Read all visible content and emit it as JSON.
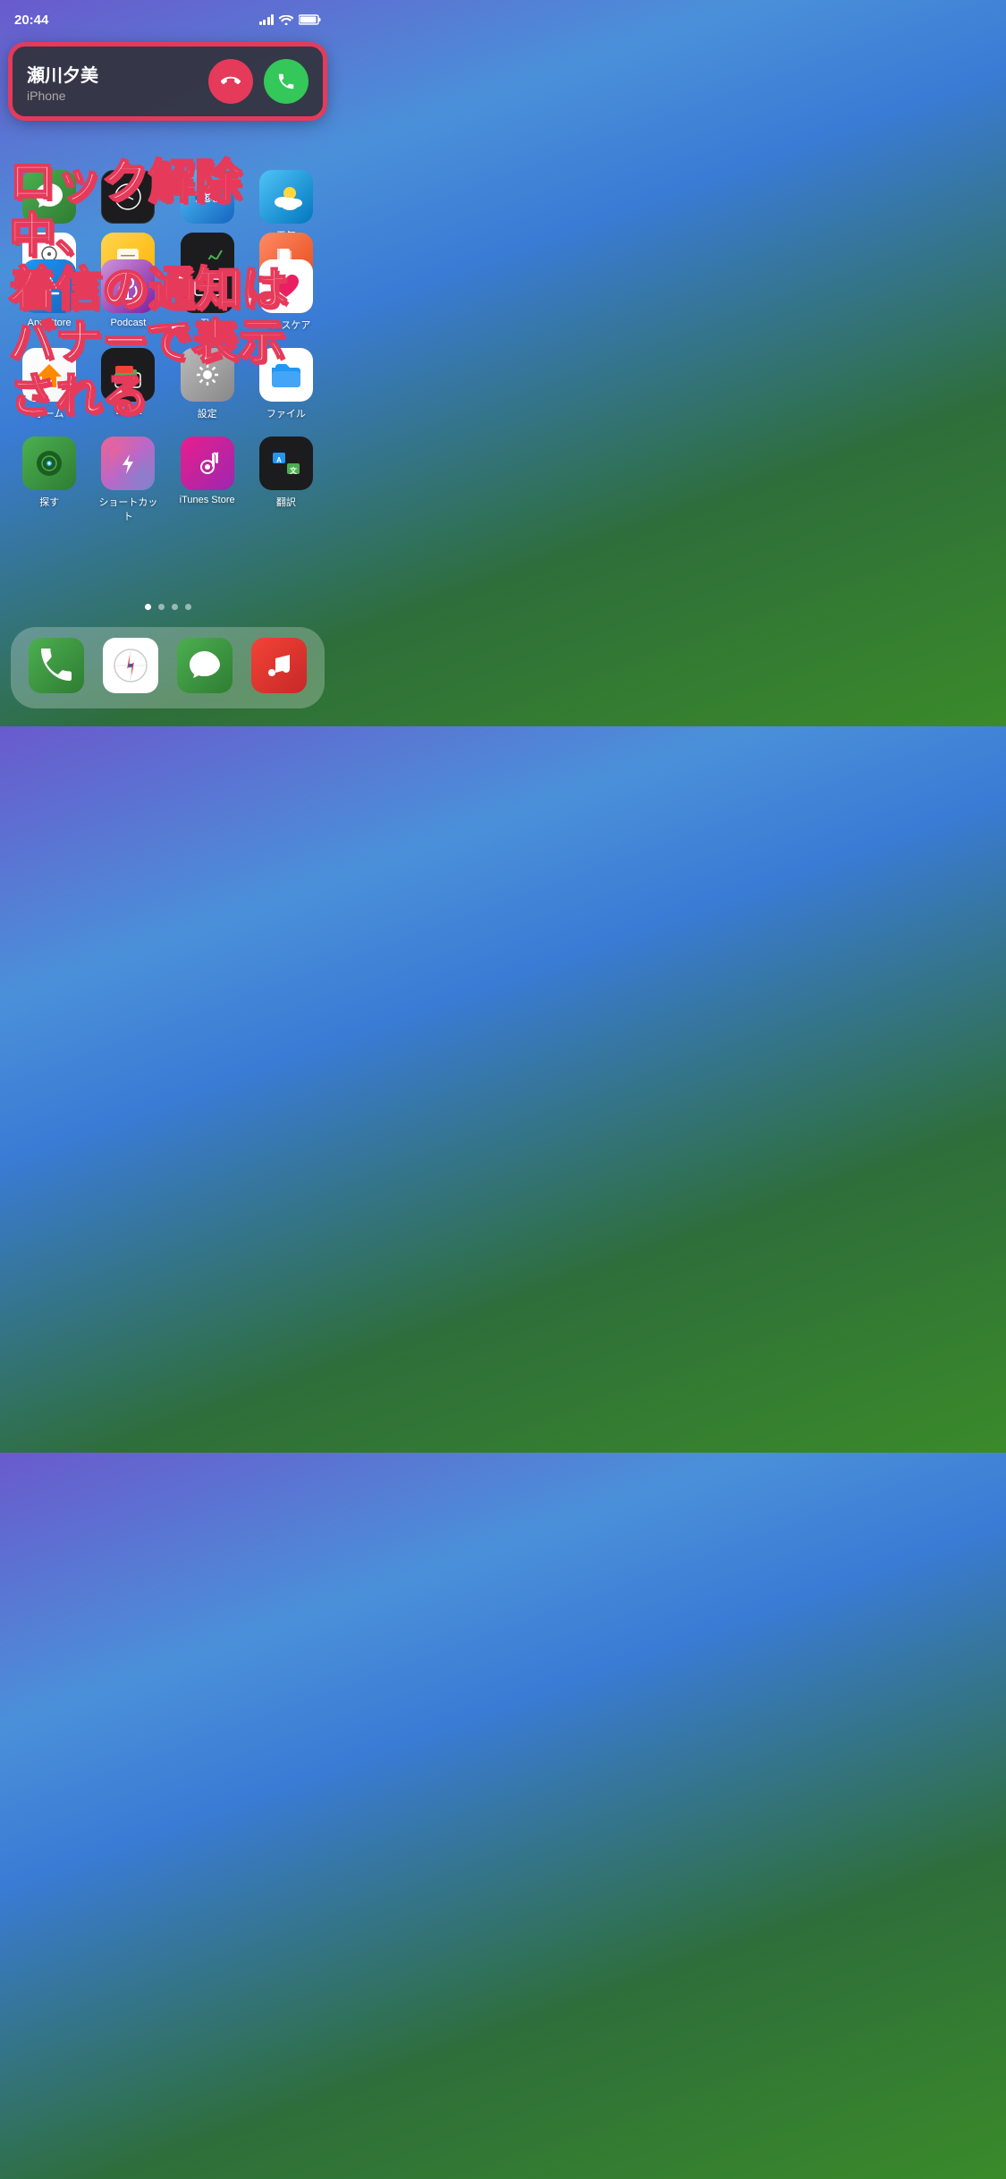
{
  "statusBar": {
    "time": "20:44"
  },
  "callBanner": {
    "callerName": "瀬川夕美",
    "callType": "iPhone",
    "declineLabel": "decline",
    "acceptLabel": "accept"
  },
  "overlayText": {
    "line1": "ロック解除中、",
    "line2": "着信の通知は",
    "line3": "バナーで表示される"
  },
  "topRowApps": [
    {
      "label": "",
      "icon": "messages-top"
    },
    {
      "label": "",
      "icon": "clock-top"
    },
    {
      "label": "",
      "icon": "maps-top"
    },
    {
      "label": "天気",
      "icon": "weather"
    }
  ],
  "middleRowApps": [
    {
      "label": "リマインダー",
      "icon": "reminders"
    },
    {
      "label": "メモ",
      "icon": "notes"
    },
    {
      "label": "株価",
      "icon": "stocks"
    },
    {
      "label": "ブック",
      "icon": "books"
    }
  ],
  "appRows": [
    [
      {
        "label": "App Store",
        "icon": "appstore"
      },
      {
        "label": "Podcast",
        "icon": "podcast"
      },
      {
        "label": "TV",
        "icon": "tv"
      },
      {
        "label": "ヘルスケア",
        "icon": "health"
      }
    ],
    [
      {
        "label": "ホーム",
        "icon": "home"
      },
      {
        "label": "Wallet",
        "icon": "wallet"
      },
      {
        "label": "設定",
        "icon": "settings"
      },
      {
        "label": "ファイル",
        "icon": "files"
      }
    ],
    [
      {
        "label": "探す",
        "icon": "findmy"
      },
      {
        "label": "ショートカット",
        "icon": "shortcuts"
      },
      {
        "label": "iTunes Store",
        "icon": "itunes"
      },
      {
        "label": "翻訳",
        "icon": "translate"
      }
    ]
  ],
  "dock": [
    {
      "label": "電話",
      "icon": "phone"
    },
    {
      "label": "Safari",
      "icon": "safari"
    },
    {
      "label": "メッセージ",
      "icon": "messages"
    },
    {
      "label": "ミュージック",
      "icon": "music"
    }
  ],
  "pageDots": [
    true,
    false,
    false,
    false
  ]
}
